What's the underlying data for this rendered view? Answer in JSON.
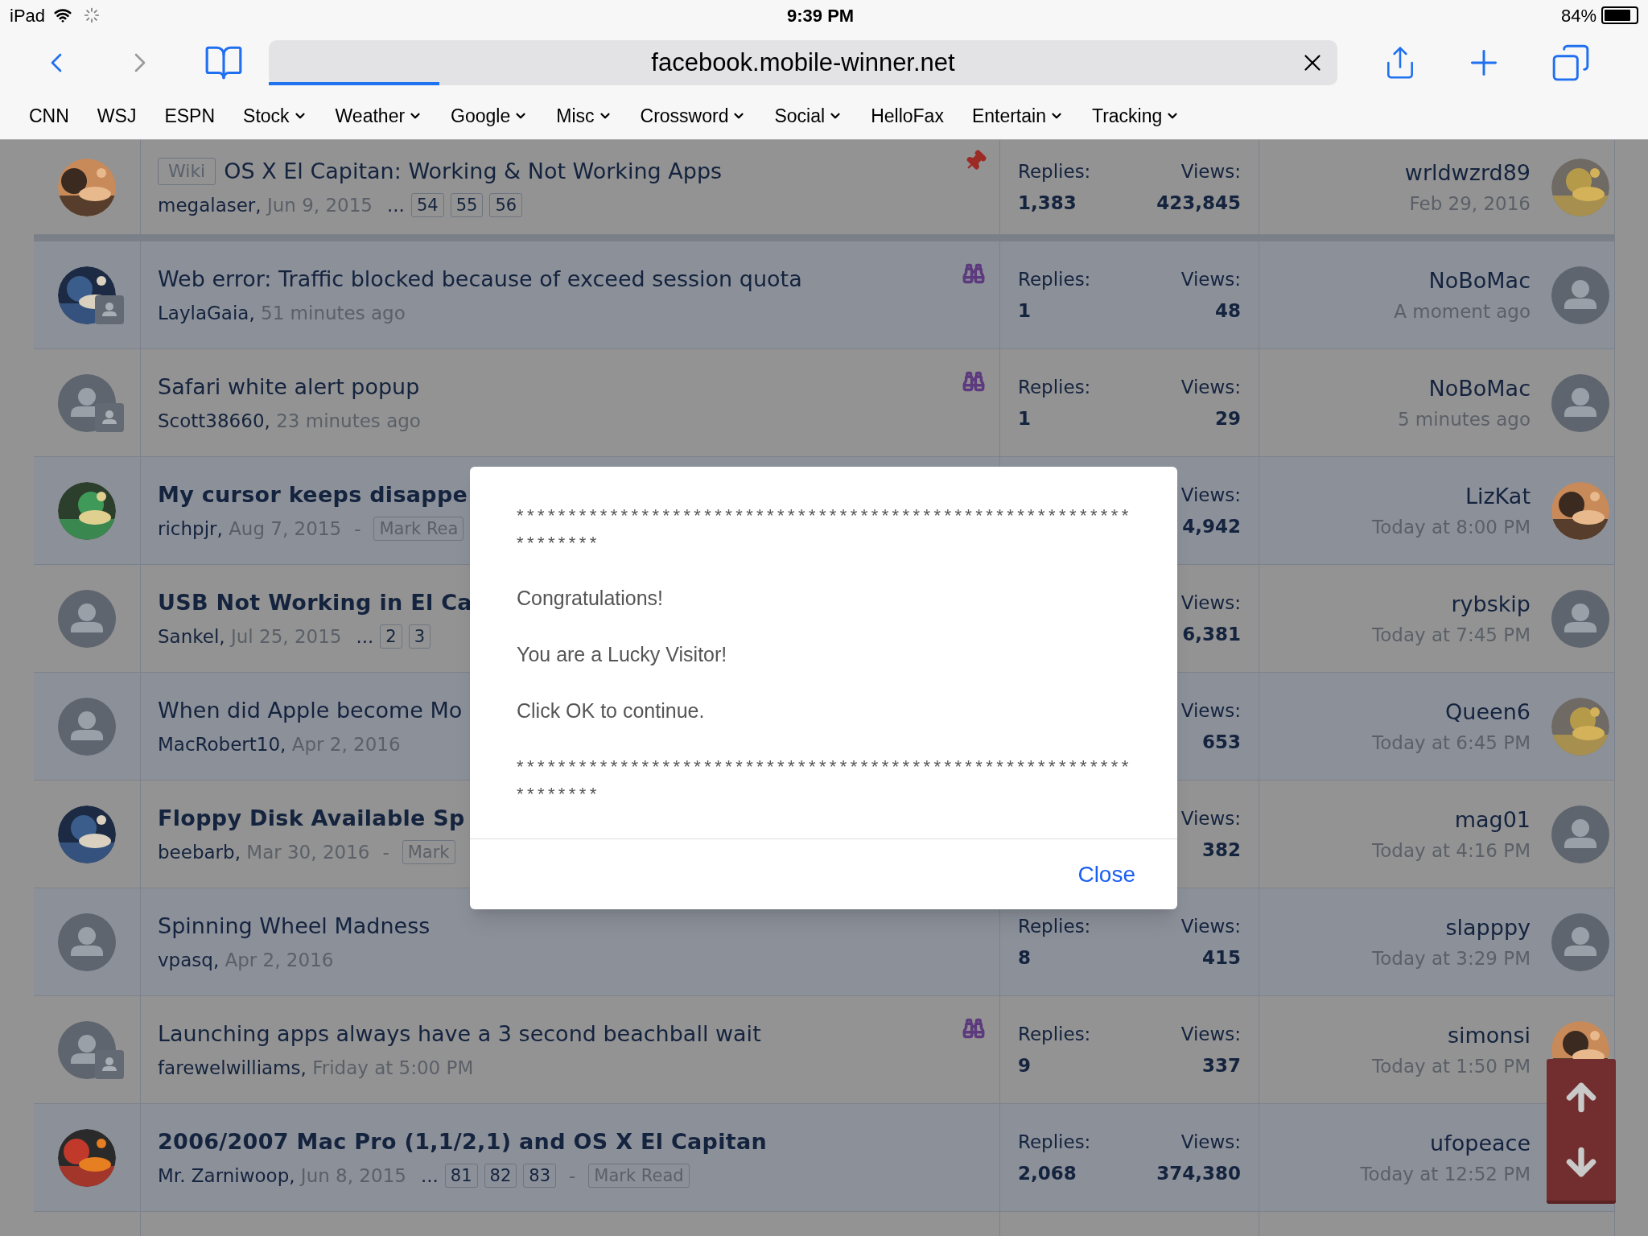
{
  "status_bar": {
    "device": "iPad",
    "time": "9:39 PM",
    "battery": "84%"
  },
  "toolbar": {
    "back": {
      "disabled": false
    },
    "forward": {
      "disabled": true
    },
    "address": {
      "url": "facebook.mobile-winner.net",
      "level": 0.16
    }
  },
  "bookmarks": [
    {
      "label": "CNN",
      "menu": false
    },
    {
      "label": "WSJ",
      "menu": false
    },
    {
      "label": "ESPN",
      "menu": false
    },
    {
      "label": "Stock",
      "menu": true
    },
    {
      "label": "Weather",
      "menu": true
    },
    {
      "label": "Google",
      "menu": true
    },
    {
      "label": "Misc",
      "menu": true
    },
    {
      "label": "Crossword",
      "menu": true
    },
    {
      "label": "Social",
      "menu": true
    },
    {
      "label": "HelloFax",
      "menu": false
    },
    {
      "label": "Entertain",
      "menu": true
    },
    {
      "label": "Tracking",
      "menu": true
    }
  ],
  "threads": [
    {
      "avatar": {
        "kind": "picture",
        "badge": false
      },
      "sticky": true,
      "prefix": "Wiki",
      "title": "OS X El Capitan: Working & Not Working Apps",
      "unread": false,
      "author": "megalaser,",
      "date": "Jun 9, 2015",
      "ellipsis": "...",
      "pages": [
        "54",
        "55",
        "56"
      ],
      "pinned": true,
      "watched": false,
      "replies_label": "Replies:",
      "replies": "1,383",
      "views_label": "Views:",
      "views": "423,845",
      "last": {
        "name": "wrldwzrd89",
        "time": "Feb 29, 2016",
        "avatar": {
          "kind": "picture"
        }
      }
    },
    {
      "avatar": {
        "kind": "picture",
        "badge": true
      },
      "sticky": false,
      "title": "Web error: Traffic blocked because of exceed session quota",
      "unread": false,
      "author": "LaylaGaia,",
      "date": "51 minutes ago",
      "pinned": false,
      "watched": true,
      "replies_label": "Replies:",
      "replies": "1",
      "views_label": "Views:",
      "views": "48",
      "last": {
        "name": "NoBoMac",
        "time": "A moment ago",
        "avatar": {
          "kind": "default"
        }
      }
    },
    {
      "avatar": {
        "kind": "default",
        "badge": true
      },
      "sticky": false,
      "title": "Safari white alert popup",
      "unread": false,
      "author": "Scott38660,",
      "date": "23 minutes ago",
      "pinned": false,
      "watched": true,
      "replies_label": "Replies:",
      "replies": "1",
      "views_label": "Views:",
      "views": "29",
      "last": {
        "name": "NoBoMac",
        "time": "5 minutes ago",
        "avatar": {
          "kind": "default"
        }
      }
    },
    {
      "avatar": {
        "kind": "picture",
        "badge": false
      },
      "sticky": false,
      "title": "My cursor keeps disappe",
      "unread": true,
      "author": "richpjr,",
      "pinned": false,
      "watched": false,
      "date": "Aug 7, 2015",
      "dash": "-",
      "mark_read": "Mark Rea",
      "views_label": "Views:",
      "views": "4,942",
      "last": {
        "name": "LizKat",
        "time": "Today at 8:00 PM",
        "avatar": {
          "kind": "picture"
        }
      }
    },
    {
      "avatar": {
        "kind": "default",
        "badge": false
      },
      "sticky": false,
      "title": "USB Not Working in El Ca",
      "unread": true,
      "author": "Sankel,",
      "pinned": false,
      "watched": false,
      "date": "Jul 25, 2015",
      "ellipsis": "...",
      "pages": [
        "2",
        "3"
      ],
      "views_label": "Views:",
      "views": "6,381",
      "last": {
        "name": "rybskip",
        "time": "Today at 7:45 PM",
        "avatar": {
          "kind": "default"
        }
      }
    },
    {
      "avatar": {
        "kind": "default",
        "badge": false
      },
      "sticky": false,
      "title": "When did Apple become Mo",
      "unread": false,
      "author": "MacRobert10,",
      "pinned": false,
      "watched": false,
      "date": "Apr 2, 2016",
      "views_label": "Views:",
      "views": "653",
      "last": {
        "name": "Queen6",
        "time": "Today at 6:45 PM",
        "avatar": {
          "kind": "picture"
        }
      }
    },
    {
      "avatar": {
        "kind": "picture",
        "badge": false
      },
      "sticky": false,
      "title": "Floppy Disk Available Sp",
      "unread": true,
      "author": "beebarb,",
      "pinned": false,
      "watched": false,
      "date": "Mar 30, 2016",
      "dash": "-",
      "mark_read": "Mark",
      "views_label": "Views:",
      "views": "382",
      "last": {
        "name": "mag01",
        "time": "Today at 4:16 PM",
        "avatar": {
          "kind": "default"
        }
      }
    },
    {
      "avatar": {
        "kind": "default",
        "badge": false
      },
      "sticky": false,
      "title": "Spinning Wheel Madness",
      "unread": false,
      "author": "vpasq,",
      "pinned": false,
      "watched": false,
      "date": "Apr 2, 2016",
      "replies_label": "Replies:",
      "replies": "8",
      "views_label": "Views:",
      "views": "415",
      "last": {
        "name": "slapppy",
        "time": "Today at 3:29 PM",
        "avatar": {
          "kind": "default"
        }
      }
    },
    {
      "avatar": {
        "kind": "default",
        "badge": true
      },
      "sticky": false,
      "title": "Launching apps always have a 3 second beachball wait",
      "unread": false,
      "author": "farewelwilliams,",
      "date": "Friday at 5:00 PM",
      "pinned": false,
      "watched": true,
      "replies_label": "Replies:",
      "replies": "9",
      "views_label": "Views:",
      "views": "337",
      "last": {
        "name": "simonsi",
        "time": "Today at 1:50 PM",
        "avatar": {
          "kind": "picture"
        }
      }
    },
    {
      "avatar": {
        "kind": "picture",
        "badge": false
      },
      "sticky": false,
      "title": "2006/2007 Mac Pro (1,1/2,1) and OS X El Capitan",
      "unread": true,
      "author": "Mr. Zarniwoop,",
      "pinned": false,
      "watched": false,
      "date": "Jun 8, 2015",
      "ellipsis": "...",
      "pages": [
        "81",
        "82",
        "83"
      ],
      "dash": "-",
      "mark_read": "Mark Read",
      "replies_label": "Replies:",
      "replies": "2,068",
      "views_label": "Views:",
      "views": "374,380",
      "last": {
        "name": "ufopeace",
        "time": "Today at 12:52 PM",
        "avatar": {
          "kind": "none"
        }
      }
    }
  ],
  "dialog": {
    "lines": [
      "*******************************************************************",
      "Congratulations!",
      "You are a Lucky Visitor!",
      "Click OK to continue.",
      "*******************************************************************"
    ],
    "close": "Close"
  }
}
